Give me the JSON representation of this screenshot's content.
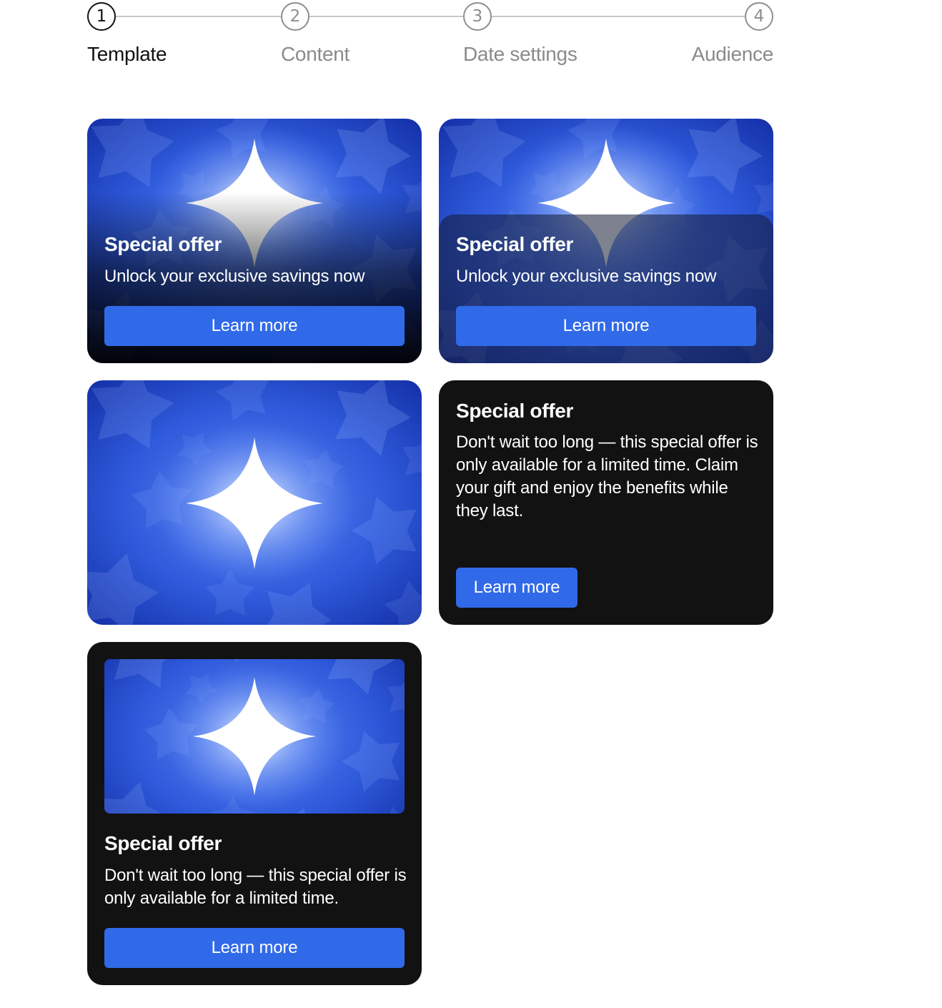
{
  "stepper": {
    "steps": [
      {
        "number": "1",
        "label": "Template",
        "state": "active"
      },
      {
        "number": "2",
        "label": "Content",
        "state": "inactive"
      },
      {
        "number": "3",
        "label": "Date settings",
        "state": "inactive"
      },
      {
        "number": "4",
        "label": "Audience",
        "state": "inactive"
      }
    ]
  },
  "templates": [
    {
      "variant": "image-background-gradient",
      "title": "Special offer",
      "subtitle": "Unlock your exclusive savings now",
      "button_label": "Learn more"
    },
    {
      "variant": "image-background-panel",
      "title": "Special offer",
      "subtitle": "Unlock your exclusive savings now",
      "button_label": "Learn more"
    },
    {
      "variant": "image-only"
    },
    {
      "variant": "text-only",
      "title": "Special offer",
      "body": "Don't wait too long — this special offer is only available for a limited time. Claim your gift and enjoy the benefits while they last.",
      "button_label": "Learn more"
    },
    {
      "variant": "image-top-text-bottom",
      "title": "Special offer",
      "body": "Don't wait too long — this special offer is only available for a limited time.",
      "button_label": "Learn more"
    }
  ],
  "colors": {
    "accent": "#316ae8",
    "card_dark": "#121212",
    "art_blue": "#2a55d6",
    "step_active": "#111111",
    "step_inactive": "#8e8e8e"
  },
  "icons": {
    "art": "sparkle-star-illustration"
  }
}
